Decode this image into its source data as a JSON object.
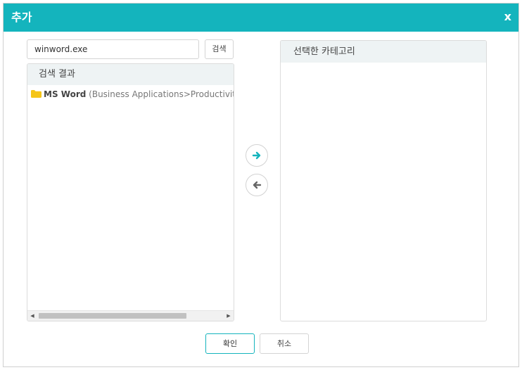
{
  "dialog": {
    "title": "추가",
    "close_label": "x"
  },
  "search": {
    "value": "winword.exe",
    "button_label": "검색"
  },
  "results": {
    "header": "검색 결과",
    "items": [
      {
        "name": "MS Word",
        "path": "(Business Applications>Productivity>Wor"
      }
    ]
  },
  "selected": {
    "header": "선택한 카테고리"
  },
  "footer": {
    "ok_label": "확인",
    "cancel_label": "취소"
  },
  "icons": {
    "move_right": "arrow-right-icon",
    "move_left": "arrow-left-icon",
    "folder": "folder-icon"
  },
  "colors": {
    "accent": "#14b4bd",
    "folder": "#f5c518",
    "arrow_right": "#14b4bd",
    "arrow_left": "#666666"
  }
}
